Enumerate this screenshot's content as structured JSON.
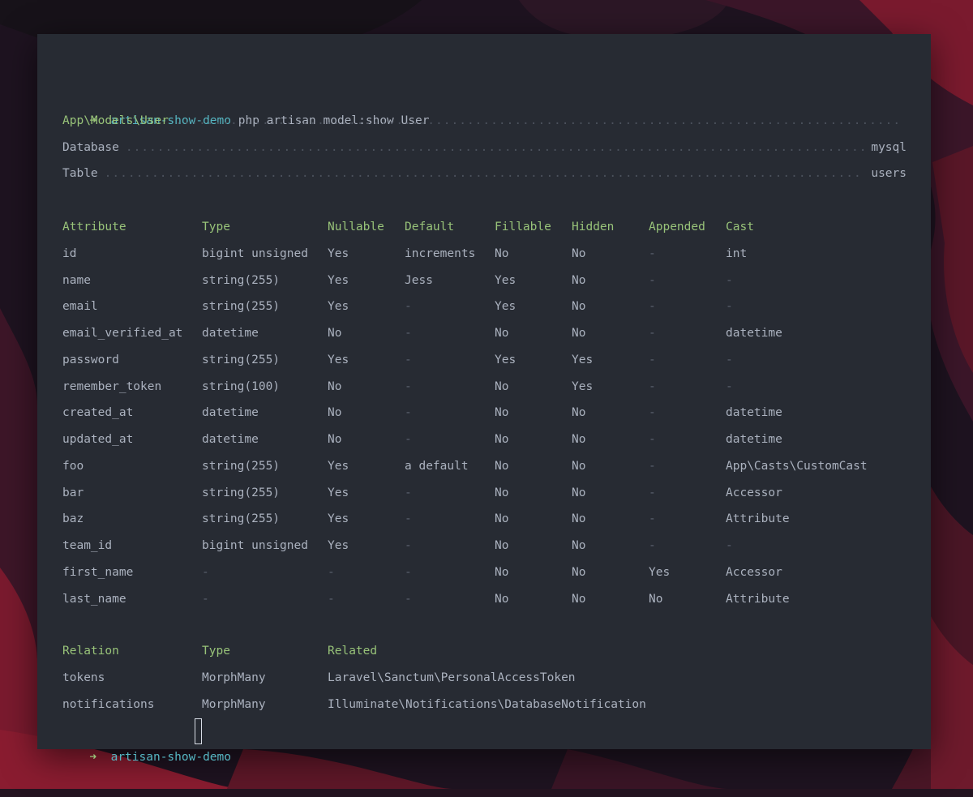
{
  "prompt": {
    "arrow": "➜",
    "directory": "artisan-show-demo",
    "command": "php artisan model:show User"
  },
  "model": {
    "class": "App\\Models\\User",
    "database_label": "Database",
    "database_value": "mysql",
    "table_label": "Table",
    "table_value": "users"
  },
  "attributes": {
    "headers": [
      "Attribute",
      "Type",
      "Nullable",
      "Default",
      "Fillable",
      "Hidden",
      "Appended",
      "Cast"
    ],
    "rows": [
      [
        "id",
        "bigint unsigned",
        "Yes",
        "increments",
        "No",
        "No",
        "-",
        "int"
      ],
      [
        "name",
        "string(255)",
        "Yes",
        "Jess",
        "Yes",
        "No",
        "-",
        "-"
      ],
      [
        "email",
        "string(255)",
        "Yes",
        "-",
        "Yes",
        "No",
        "-",
        "-"
      ],
      [
        "email_verified_at",
        "datetime",
        "No",
        "-",
        "No",
        "No",
        "-",
        "datetime"
      ],
      [
        "password",
        "string(255)",
        "Yes",
        "-",
        "Yes",
        "Yes",
        "-",
        "-"
      ],
      [
        "remember_token",
        "string(100)",
        "No",
        "-",
        "No",
        "Yes",
        "-",
        "-"
      ],
      [
        "created_at",
        "datetime",
        "No",
        "-",
        "No",
        "No",
        "-",
        "datetime"
      ],
      [
        "updated_at",
        "datetime",
        "No",
        "-",
        "No",
        "No",
        "-",
        "datetime"
      ],
      [
        "foo",
        "string(255)",
        "Yes",
        "a default",
        "No",
        "No",
        "-",
        "App\\Casts\\CustomCast"
      ],
      [
        "bar",
        "string(255)",
        "Yes",
        "-",
        "No",
        "No",
        "-",
        "Accessor"
      ],
      [
        "baz",
        "string(255)",
        "Yes",
        "-",
        "No",
        "No",
        "-",
        "Attribute"
      ],
      [
        "team_id",
        "bigint unsigned",
        "Yes",
        "-",
        "No",
        "No",
        "-",
        "-"
      ],
      [
        "first_name",
        "-",
        "-",
        "-",
        "No",
        "No",
        "Yes",
        "Accessor"
      ],
      [
        "last_name",
        "-",
        "-",
        "-",
        "No",
        "No",
        "No",
        "Attribute"
      ]
    ]
  },
  "relations": {
    "headers": [
      "Relation",
      "Type",
      "Related"
    ],
    "rows": [
      [
        "tokens",
        "MorphMany",
        "Laravel\\Sanctum\\PersonalAccessToken"
      ],
      [
        "notifications",
        "MorphMany",
        "Illuminate\\Notifications\\DatabaseNotification"
      ]
    ]
  },
  "colors": {
    "terminal_bg": "#272b33",
    "text": "#abb2bf",
    "green": "#98c379",
    "cyan": "#56b6c2",
    "dim": "#5c6370"
  }
}
